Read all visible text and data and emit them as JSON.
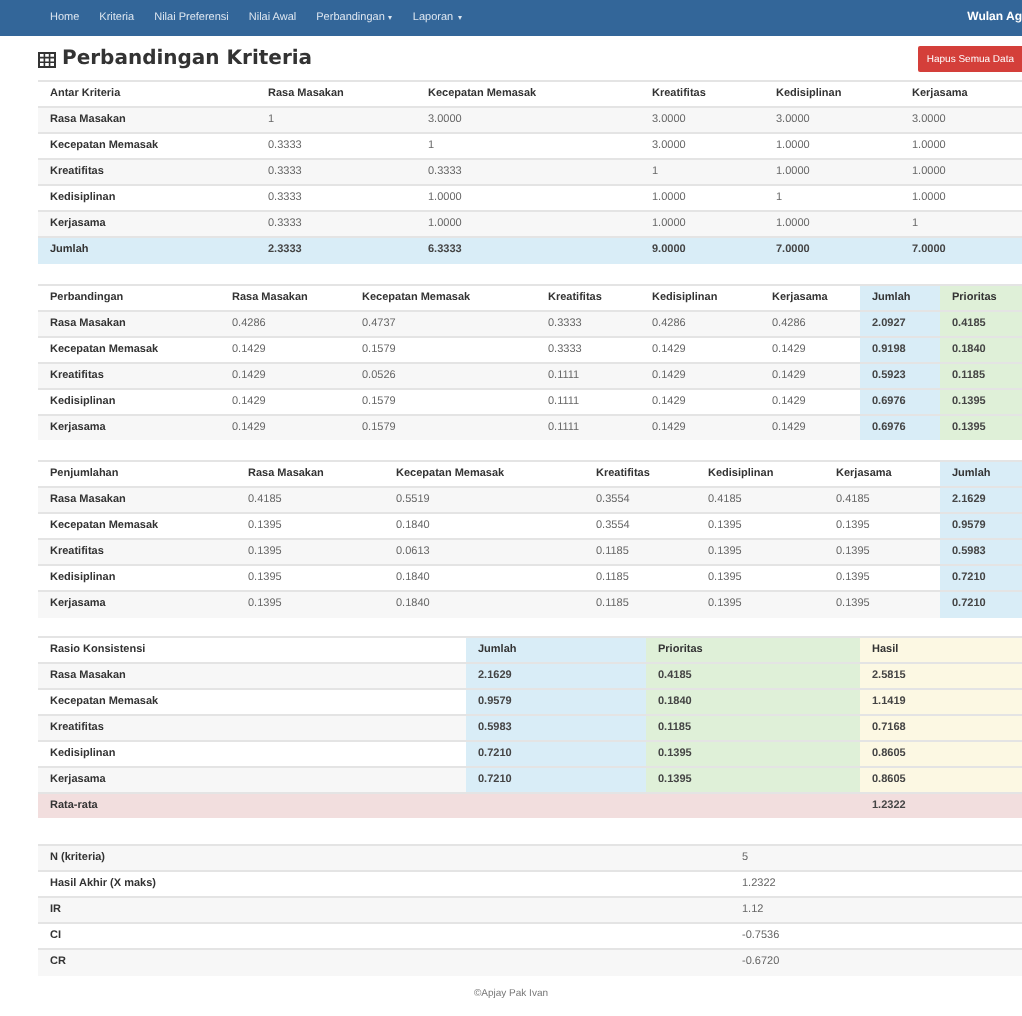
{
  "navbar": {
    "items": [
      {
        "label": "Home",
        "kind": "link"
      },
      {
        "label": "Kriteria",
        "kind": "link"
      },
      {
        "label": "Nilai Preferensi",
        "kind": "link"
      },
      {
        "label": "Nilai Awal",
        "kind": "link"
      },
      {
        "label": "Perbandingan",
        "kind": "dropdown"
      },
      {
        "label": "Laporan",
        "kind": "dropdown"
      }
    ],
    "user": "Wulan Ag"
  },
  "page_title": "Perbandingan Kriteria",
  "delete_button": "Hapus Semua Data",
  "tables": [
    {
      "columns": [
        {
          "label": "Antar Kriteria"
        },
        {
          "label": "Rasa Masakan"
        },
        {
          "label": "Kecepatan Memasak"
        },
        {
          "label": "Kreatifitas"
        },
        {
          "label": "Kedisiplinan"
        },
        {
          "label": "Kerjasama"
        }
      ],
      "rows": [
        {
          "cells": [
            "Rasa Masakan",
            "1",
            "3.0000",
            "3.0000",
            "3.0000",
            "3.0000"
          ]
        },
        {
          "cells": [
            "Kecepatan Memasak",
            "0.3333",
            "1",
            "3.0000",
            "1.0000",
            "1.0000"
          ]
        },
        {
          "cells": [
            "Kreatifitas",
            "0.3333",
            "0.3333",
            "1",
            "1.0000",
            "1.0000"
          ]
        },
        {
          "cells": [
            "Kedisiplinan",
            "0.3333",
            "1.0000",
            "1.0000",
            "1",
            "1.0000"
          ]
        },
        {
          "cells": [
            "Kerjasama",
            "0.3333",
            "1.0000",
            "1.0000",
            "1.0000",
            "1"
          ]
        },
        {
          "cells": [
            "Jumlah",
            "2.3333",
            "6.3333",
            "9.0000",
            "7.0000",
            "7.0000"
          ],
          "color": "#d9edf7"
        }
      ]
    },
    {
      "columns": [
        {
          "label": "Perbandingan"
        },
        {
          "label": "Rasa Masakan"
        },
        {
          "label": "Kecepatan Memasak"
        },
        {
          "label": "Kreatifitas"
        },
        {
          "label": "Kedisiplinan"
        },
        {
          "label": "Kerjasama"
        },
        {
          "label": "Jumlah",
          "color": "#d9edf7"
        },
        {
          "label": "Prioritas",
          "color": "#dff0d8"
        }
      ],
      "rows": [
        {
          "cells": [
            "Rasa Masakan",
            "0.4286",
            "0.4737",
            "0.3333",
            "0.4286",
            "0.4286",
            "2.0927",
            "0.4185"
          ]
        },
        {
          "cells": [
            "Kecepatan Memasak",
            "0.1429",
            "0.1579",
            "0.3333",
            "0.1429",
            "0.1429",
            "0.9198",
            "0.1840"
          ]
        },
        {
          "cells": [
            "Kreatifitas",
            "0.1429",
            "0.0526",
            "0.1111",
            "0.1429",
            "0.1429",
            "0.5923",
            "0.1185"
          ]
        },
        {
          "cells": [
            "Kedisiplinan",
            "0.1429",
            "0.1579",
            "0.1111",
            "0.1429",
            "0.1429",
            "0.6976",
            "0.1395"
          ]
        },
        {
          "cells": [
            "Kerjasama",
            "0.1429",
            "0.1579",
            "0.1111",
            "0.1429",
            "0.1429",
            "0.6976",
            "0.1395"
          ]
        }
      ]
    },
    {
      "columns": [
        {
          "label": "Penjumlahan"
        },
        {
          "label": "Rasa Masakan"
        },
        {
          "label": "Kecepatan Memasak"
        },
        {
          "label": "Kreatifitas"
        },
        {
          "label": "Kedisiplinan"
        },
        {
          "label": "Kerjasama"
        },
        {
          "label": "Jumlah",
          "color": "#d9edf7"
        }
      ],
      "rows": [
        {
          "cells": [
            "Rasa Masakan",
            "0.4185",
            "0.5519",
            "0.3554",
            "0.4185",
            "0.4185",
            "2.1629"
          ]
        },
        {
          "cells": [
            "Kecepatan Memasak",
            "0.1395",
            "0.1840",
            "0.3554",
            "0.1395",
            "0.1395",
            "0.9579"
          ]
        },
        {
          "cells": [
            "Kreatifitas",
            "0.1395",
            "0.0613",
            "0.1185",
            "0.1395",
            "0.1395",
            "0.5983"
          ]
        },
        {
          "cells": [
            "Kedisiplinan",
            "0.1395",
            "0.1840",
            "0.1185",
            "0.1395",
            "0.1395",
            "0.7210"
          ]
        },
        {
          "cells": [
            "Kerjasama",
            "0.1395",
            "0.1840",
            "0.1185",
            "0.1395",
            "0.1395",
            "0.7210"
          ]
        }
      ]
    },
    {
      "columns": [
        {
          "label": "Rasio Konsistensi"
        },
        {
          "label": "Jumlah",
          "color": "#d9edf7"
        },
        {
          "label": "Prioritas",
          "color": "#dff0d8"
        },
        {
          "label": "Hasil",
          "color": "#fcf8e3"
        }
      ],
      "rows": [
        {
          "cells": [
            "Rasa Masakan",
            "2.1629",
            "0.4185",
            "2.5815"
          ]
        },
        {
          "cells": [
            "Kecepatan Memasak",
            "0.9579",
            "0.1840",
            "1.1419"
          ]
        },
        {
          "cells": [
            "Kreatifitas",
            "0.5983",
            "0.1185",
            "0.7168"
          ]
        },
        {
          "cells": [
            "Kedisiplinan",
            "0.7210",
            "0.1395",
            "0.8605"
          ]
        },
        {
          "cells": [
            "Kerjasama",
            "0.7210",
            "0.1395",
            "0.8605"
          ]
        },
        {
          "cells": [
            "Rata-rata",
            "",
            "",
            "1.2322"
          ],
          "color": "#f2dede"
        }
      ]
    },
    {
      "rows": [
        {
          "cells": [
            "N (kriteria)",
            "5"
          ]
        },
        {
          "cells": [
            "Hasil Akhir (X maks)",
            "1.2322"
          ]
        },
        {
          "cells": [
            "IR",
            "1.12"
          ]
        },
        {
          "cells": [
            "CI",
            "-0.7536"
          ]
        },
        {
          "cells": [
            "CR",
            "-0.6720"
          ]
        }
      ]
    }
  ],
  "footer": "©Apjay Pak Ivan"
}
